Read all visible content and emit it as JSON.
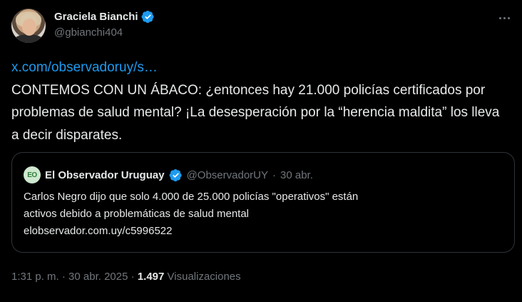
{
  "author": {
    "display_name": "Graciela Bianchi",
    "handle": "@gbianchi404",
    "verified_color": "#1d9bf0"
  },
  "tweet": {
    "link": "x.com/observadoruy/s…",
    "text": "CONTEMOS CON UN ÁBACO: ¿entonces hay 21.000 policías certificados por problemas de salud mental? ¡La desesperación por la “herencia maldita” los lleva a decir disparates."
  },
  "quote": {
    "logo_text": "EO",
    "display_name": "El Observador Uruguay",
    "handle": "@ObservadorUY",
    "separator": "·",
    "date": "30 abr.",
    "text_line1": "Carlos Negro dijo que solo 4.000 de 25.000 policías \"operativos\" están",
    "text_line2": "activos debido a problemáticas de salud mental",
    "text_line3": "elobservador.com.uy/c5996522"
  },
  "meta": {
    "time": "1:31 p. m.",
    "sep1": "·",
    "date": "30 abr. 2025",
    "sep2": "·",
    "views_count": "1.497",
    "views_label": "Visualizaciones"
  },
  "icons": {
    "more": "more-icon",
    "verified": "verified-badge-icon"
  }
}
